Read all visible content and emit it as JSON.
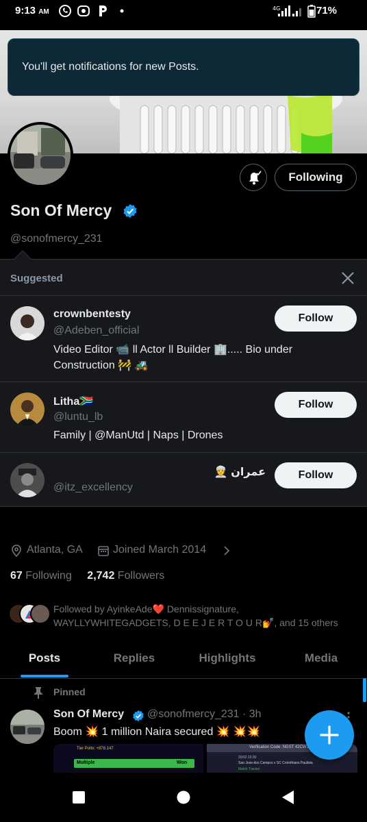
{
  "status_bar": {
    "time": "9:13",
    "ampm": "AM",
    "battery": "71%",
    "icons": [
      "whatsapp-icon",
      "record-icon",
      "parking-icon",
      "dot-icon",
      "signal-icon",
      "battery-icon"
    ]
  },
  "toast": {
    "text": "You'll get notifications for new Posts."
  },
  "profile": {
    "display_name": "Son Of Mercy",
    "handle": "@sonofmercy_231",
    "following_button": "Following",
    "location": "Atlanta, GA",
    "joined": "Joined March 2014",
    "following_count": "67",
    "following_label": "Following",
    "followers_count": "2,742",
    "followers_label": "Followers",
    "followed_by": "Followed by AyinkeAde❤️ Dennissignature, WAYLLYWHITEGADGETS, D E E J E R T O U R💅, and 15 others"
  },
  "suggested": {
    "title": "Suggested",
    "items": [
      {
        "name": "crownbentesty",
        "handle": "@Adeben_official",
        "bio": "Video Editor 📹 ll Actor ll Builder 🏢..... Bio under Construction 🚧 🚜",
        "button": "Follow"
      },
      {
        "name": "Litha🇿🇦",
        "handle": "@luntu_lb",
        "bio": "Family | @ManUtd | Naps | Drones",
        "button": "Follow"
      },
      {
        "name": "عمران 👳",
        "handle": "@itz_excellency",
        "bio": "",
        "button": "Follow"
      }
    ]
  },
  "tabs": [
    "Posts",
    "Replies",
    "Highlights",
    "Media"
  ],
  "active_tab": "Posts",
  "post": {
    "pinned_label": "Pinned",
    "author": "Son Of Mercy",
    "handle_time": "@sonofmercy_231 · 3h",
    "text": "Boom 💥 1 million Naira secured  💥 💥💥",
    "image1_header": "Tier Pollo: +878.147",
    "image1_row": "Multiple",
    "image1_badge": "Won",
    "image2_header": "Verification Code: NGST 42CW1",
    "image2_date": "20/02 23:30",
    "image2_match": "Sao Jose-dos Campos v SC Corinthians Paulista",
    "image2_tracker": "Match Tracker"
  },
  "colors": {
    "accent": "#1d9bf0",
    "background": "#000000",
    "toast_bg": "#0d2935",
    "suggest_bg": "#16181c",
    "muted": "#71767b"
  }
}
